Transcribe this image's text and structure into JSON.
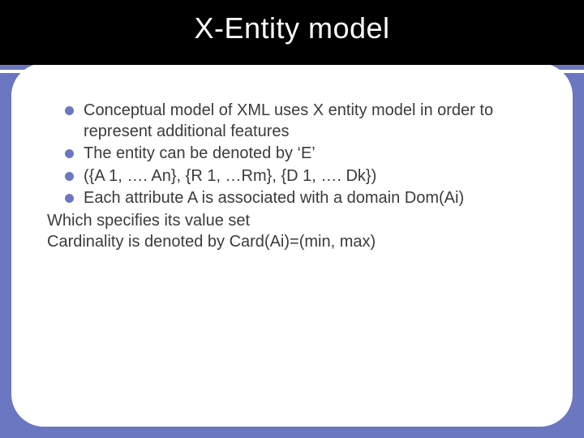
{
  "title": "X-Entity model",
  "bullets": [
    "Conceptual model of XML uses X entity model in order to represent additional features",
    "The entity can be denoted by ‘E’",
    "({A 1, …. An}, {R 1, …Rm}, {D 1, …. Dk})",
    "Each attribute A is associated with a domain Dom(Ai)"
  ],
  "trailing": [
    "Which specifies its value set",
    "Cardinality is denoted by Card(Ai)=(min, max)"
  ]
}
